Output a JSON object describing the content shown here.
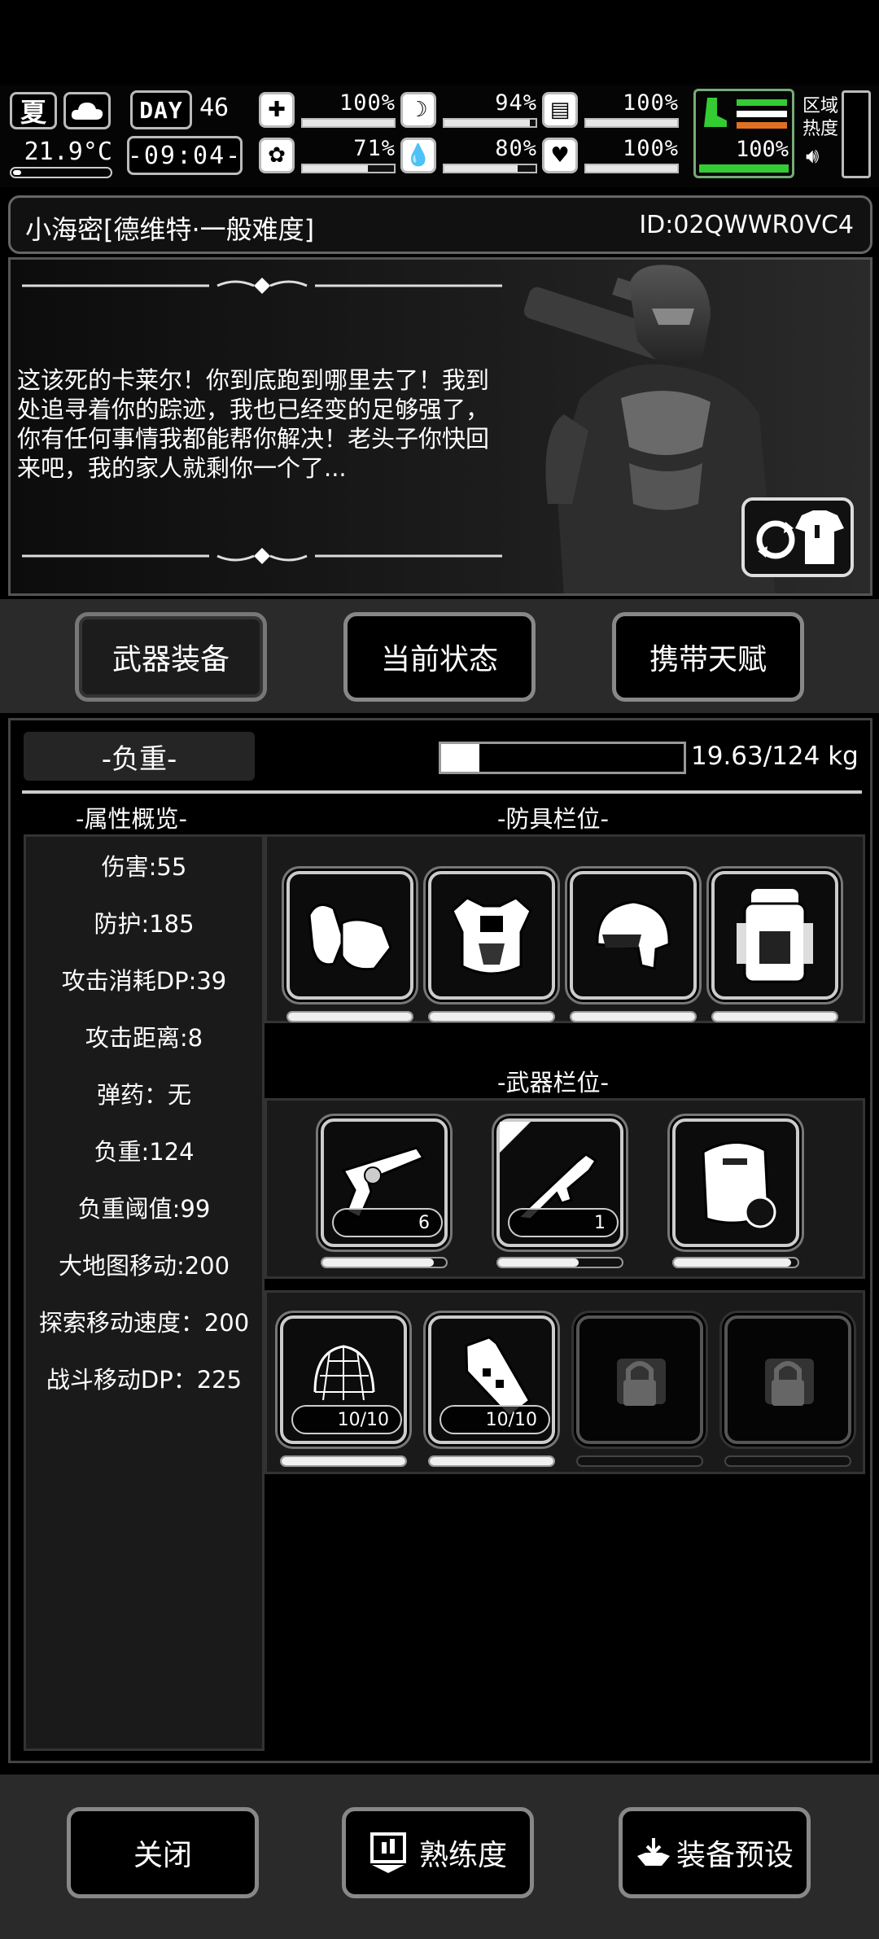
{
  "hud": {
    "season": "夏",
    "temperature": "21.9°C",
    "day_label": "DAY",
    "day_number": "46",
    "time": "-09:04-",
    "stats": [
      {
        "name": "health",
        "icon": "medkit-icon",
        "value": "100%",
        "level": 1.0
      },
      {
        "name": "hunger",
        "icon": "stomach-icon",
        "value": "94%",
        "level": 0.94
      },
      {
        "name": "energy",
        "icon": "battery-icon",
        "value": "100%",
        "level": 1.0
      },
      {
        "name": "sanity",
        "icon": "brain-icon",
        "value": "71%",
        "level": 0.71
      },
      {
        "name": "thirst",
        "icon": "water-drop-icon",
        "value": "80%",
        "level": 0.8
      },
      {
        "name": "mood",
        "icon": "heart-icon",
        "value": "100%",
        "level": 1.0
      }
    ],
    "stamina": {
      "value": "100%",
      "level": 1.0,
      "icon": "boot-icon"
    },
    "zone_label": "区域\n热度",
    "accent_green": "#33cc33"
  },
  "character": {
    "name": "小海密[德维特·一般难度]",
    "id": "ID:02QWWR0VC4",
    "story": "这该死的卡莱尔！你到底跑到哪里去了！我到处追寻着你的踪迹，我也已经变的足够强了，你有任何事情我都能帮你解决！老头子你快回来吧，我的家人就剩你一个了..."
  },
  "tabs": [
    "武器装备",
    "当前状态",
    "携带天赋"
  ],
  "equipment": {
    "weight_title": "-负重-",
    "weight_text": "19.63/124 kg",
    "weight_fraction": 0.158,
    "attrs_title": "-属性概览-",
    "attrs": [
      "伤害:55",
      "防护:185",
      "攻击消耗DP:39",
      "攻击距离:8",
      "弹药：无",
      "负重:124",
      "负重阈值:99",
      "大地图移动:200",
      "探索移动速度：200",
      "战斗移动DP：225"
    ],
    "armor_title": "-防具栏位-",
    "armor_slots": [
      {
        "icon": "gloves-icon",
        "durability": 1.0
      },
      {
        "icon": "body-armor-icon",
        "durability": 1.0
      },
      {
        "icon": "helmet-icon",
        "durability": 1.0
      },
      {
        "icon": "backpack-icon",
        "durability": 1.0
      }
    ],
    "weapon_title": "-武器栏位-",
    "weapon_slots": [
      {
        "icon": "revolver-icon",
        "ammo": "6",
        "durability": 0.9
      },
      {
        "icon": "submachine-gun-icon",
        "ammo": "1",
        "durability": 0.65
      },
      {
        "icon": "riot-shield-icon",
        "ammo": "",
        "durability": 0.95
      }
    ],
    "item_slots": [
      {
        "icon": "net-icon",
        "count": "10/10",
        "durability": 1.0,
        "locked": false
      },
      {
        "icon": "grenade-icon",
        "count": "10/10",
        "durability": 1.0,
        "locked": false
      },
      {
        "icon": "lock-icon",
        "count": "",
        "durability": 0,
        "locked": true
      },
      {
        "icon": "lock-icon",
        "count": "",
        "durability": 0,
        "locked": true
      }
    ]
  },
  "bottom": {
    "close": "关闭",
    "proficiency": "熟练度",
    "preset": "装备预设"
  }
}
